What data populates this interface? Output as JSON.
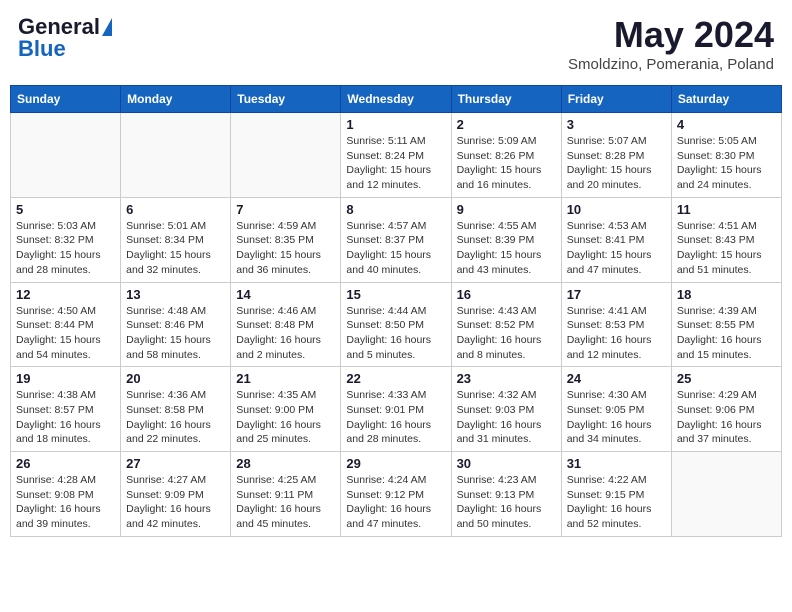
{
  "header": {
    "logo": {
      "general": "General",
      "blue": "Blue"
    },
    "title": "May 2024",
    "location": "Smoldzino, Pomerania, Poland"
  },
  "days_of_week": [
    "Sunday",
    "Monday",
    "Tuesday",
    "Wednesday",
    "Thursday",
    "Friday",
    "Saturday"
  ],
  "weeks": [
    [
      {
        "day": "",
        "empty": true
      },
      {
        "day": "",
        "empty": true
      },
      {
        "day": "",
        "empty": true
      },
      {
        "day": "1",
        "sunrise": "Sunrise: 5:11 AM",
        "sunset": "Sunset: 8:24 PM",
        "daylight": "Daylight: 15 hours and 12 minutes."
      },
      {
        "day": "2",
        "sunrise": "Sunrise: 5:09 AM",
        "sunset": "Sunset: 8:26 PM",
        "daylight": "Daylight: 15 hours and 16 minutes."
      },
      {
        "day": "3",
        "sunrise": "Sunrise: 5:07 AM",
        "sunset": "Sunset: 8:28 PM",
        "daylight": "Daylight: 15 hours and 20 minutes."
      },
      {
        "day": "4",
        "sunrise": "Sunrise: 5:05 AM",
        "sunset": "Sunset: 8:30 PM",
        "daylight": "Daylight: 15 hours and 24 minutes."
      }
    ],
    [
      {
        "day": "5",
        "sunrise": "Sunrise: 5:03 AM",
        "sunset": "Sunset: 8:32 PM",
        "daylight": "Daylight: 15 hours and 28 minutes."
      },
      {
        "day": "6",
        "sunrise": "Sunrise: 5:01 AM",
        "sunset": "Sunset: 8:34 PM",
        "daylight": "Daylight: 15 hours and 32 minutes."
      },
      {
        "day": "7",
        "sunrise": "Sunrise: 4:59 AM",
        "sunset": "Sunset: 8:35 PM",
        "daylight": "Daylight: 15 hours and 36 minutes."
      },
      {
        "day": "8",
        "sunrise": "Sunrise: 4:57 AM",
        "sunset": "Sunset: 8:37 PM",
        "daylight": "Daylight: 15 hours and 40 minutes."
      },
      {
        "day": "9",
        "sunrise": "Sunrise: 4:55 AM",
        "sunset": "Sunset: 8:39 PM",
        "daylight": "Daylight: 15 hours and 43 minutes."
      },
      {
        "day": "10",
        "sunrise": "Sunrise: 4:53 AM",
        "sunset": "Sunset: 8:41 PM",
        "daylight": "Daylight: 15 hours and 47 minutes."
      },
      {
        "day": "11",
        "sunrise": "Sunrise: 4:51 AM",
        "sunset": "Sunset: 8:43 PM",
        "daylight": "Daylight: 15 hours and 51 minutes."
      }
    ],
    [
      {
        "day": "12",
        "sunrise": "Sunrise: 4:50 AM",
        "sunset": "Sunset: 8:44 PM",
        "daylight": "Daylight: 15 hours and 54 minutes."
      },
      {
        "day": "13",
        "sunrise": "Sunrise: 4:48 AM",
        "sunset": "Sunset: 8:46 PM",
        "daylight": "Daylight: 15 hours and 58 minutes."
      },
      {
        "day": "14",
        "sunrise": "Sunrise: 4:46 AM",
        "sunset": "Sunset: 8:48 PM",
        "daylight": "Daylight: 16 hours and 2 minutes."
      },
      {
        "day": "15",
        "sunrise": "Sunrise: 4:44 AM",
        "sunset": "Sunset: 8:50 PM",
        "daylight": "Daylight: 16 hours and 5 minutes."
      },
      {
        "day": "16",
        "sunrise": "Sunrise: 4:43 AM",
        "sunset": "Sunset: 8:52 PM",
        "daylight": "Daylight: 16 hours and 8 minutes."
      },
      {
        "day": "17",
        "sunrise": "Sunrise: 4:41 AM",
        "sunset": "Sunset: 8:53 PM",
        "daylight": "Daylight: 16 hours and 12 minutes."
      },
      {
        "day": "18",
        "sunrise": "Sunrise: 4:39 AM",
        "sunset": "Sunset: 8:55 PM",
        "daylight": "Daylight: 16 hours and 15 minutes."
      }
    ],
    [
      {
        "day": "19",
        "sunrise": "Sunrise: 4:38 AM",
        "sunset": "Sunset: 8:57 PM",
        "daylight": "Daylight: 16 hours and 18 minutes."
      },
      {
        "day": "20",
        "sunrise": "Sunrise: 4:36 AM",
        "sunset": "Sunset: 8:58 PM",
        "daylight": "Daylight: 16 hours and 22 minutes."
      },
      {
        "day": "21",
        "sunrise": "Sunrise: 4:35 AM",
        "sunset": "Sunset: 9:00 PM",
        "daylight": "Daylight: 16 hours and 25 minutes."
      },
      {
        "day": "22",
        "sunrise": "Sunrise: 4:33 AM",
        "sunset": "Sunset: 9:01 PM",
        "daylight": "Daylight: 16 hours and 28 minutes."
      },
      {
        "day": "23",
        "sunrise": "Sunrise: 4:32 AM",
        "sunset": "Sunset: 9:03 PM",
        "daylight": "Daylight: 16 hours and 31 minutes."
      },
      {
        "day": "24",
        "sunrise": "Sunrise: 4:30 AM",
        "sunset": "Sunset: 9:05 PM",
        "daylight": "Daylight: 16 hours and 34 minutes."
      },
      {
        "day": "25",
        "sunrise": "Sunrise: 4:29 AM",
        "sunset": "Sunset: 9:06 PM",
        "daylight": "Daylight: 16 hours and 37 minutes."
      }
    ],
    [
      {
        "day": "26",
        "sunrise": "Sunrise: 4:28 AM",
        "sunset": "Sunset: 9:08 PM",
        "daylight": "Daylight: 16 hours and 39 minutes."
      },
      {
        "day": "27",
        "sunrise": "Sunrise: 4:27 AM",
        "sunset": "Sunset: 9:09 PM",
        "daylight": "Daylight: 16 hours and 42 minutes."
      },
      {
        "day": "28",
        "sunrise": "Sunrise: 4:25 AM",
        "sunset": "Sunset: 9:11 PM",
        "daylight": "Daylight: 16 hours and 45 minutes."
      },
      {
        "day": "29",
        "sunrise": "Sunrise: 4:24 AM",
        "sunset": "Sunset: 9:12 PM",
        "daylight": "Daylight: 16 hours and 47 minutes."
      },
      {
        "day": "30",
        "sunrise": "Sunrise: 4:23 AM",
        "sunset": "Sunset: 9:13 PM",
        "daylight": "Daylight: 16 hours and 50 minutes."
      },
      {
        "day": "31",
        "sunrise": "Sunrise: 4:22 AM",
        "sunset": "Sunset: 9:15 PM",
        "daylight": "Daylight: 16 hours and 52 minutes."
      },
      {
        "day": "",
        "empty": true
      }
    ]
  ]
}
